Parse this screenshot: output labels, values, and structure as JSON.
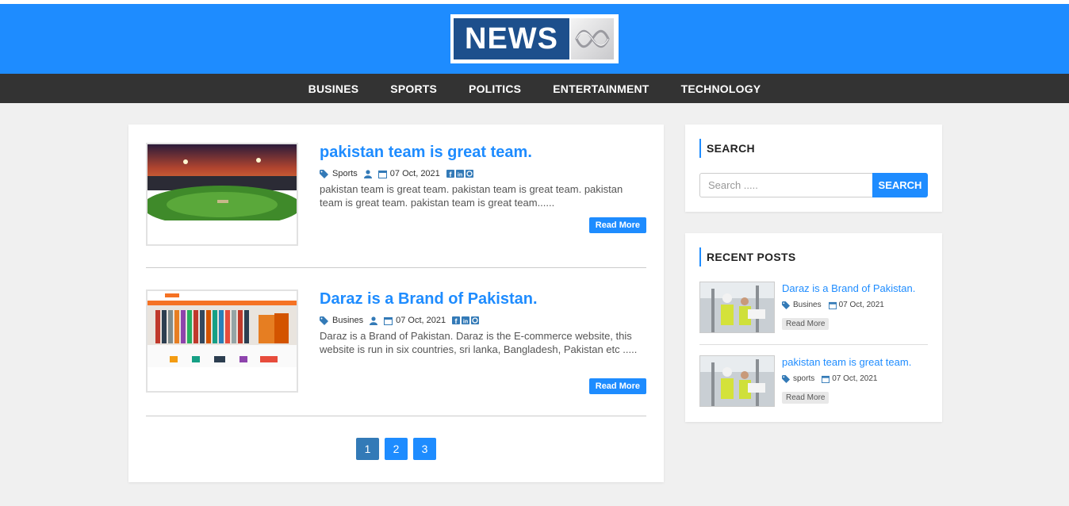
{
  "brand": {
    "logo_text": "NEWS"
  },
  "nav": {
    "items": [
      "BUSINES",
      "SPORTS",
      "POLITICS",
      "ENTERTAINMENT",
      "TECHNOLOGY"
    ]
  },
  "posts": [
    {
      "title": "pakistan team is great team.",
      "category": "Sports",
      "date": "07 Oct, 2021",
      "excerpt": "pakistan team is great team. pakistan team is great team. pakistan team is great team. pakistan team is great team......",
      "read_more": "Read More"
    },
    {
      "title": "Daraz is a Brand of Pakistan.",
      "category": "Busines",
      "date": "07 Oct, 2021",
      "excerpt": "Daraz is a Brand of Pakistan. Daraz is the E-commerce website, this website is run in six countries, sri lanka, Bangladesh, Pakistan etc .....",
      "read_more": "Read More"
    }
  ],
  "pagination": {
    "pages": [
      "1",
      "2",
      "3"
    ],
    "active": "1"
  },
  "search_widget": {
    "title": "SEARCH",
    "placeholder": "Search .....",
    "button": "SEARCH"
  },
  "recent_widget": {
    "title": "RECENT POSTS",
    "posts": [
      {
        "title": "Daraz is a Brand of Pakistan.",
        "category": "Busines",
        "date": "07 Oct, 2021",
        "read_more": "Read More"
      },
      {
        "title": "pakistan team is great team.",
        "category": "sports",
        "date": "07 Oct, 2021",
        "read_more": "Read More"
      }
    ]
  },
  "colors": {
    "accent": "#1e8cff",
    "nav_bg": "#333333",
    "logo_blue": "#1d4f8c",
    "page_bg": "#f0f0f0"
  }
}
